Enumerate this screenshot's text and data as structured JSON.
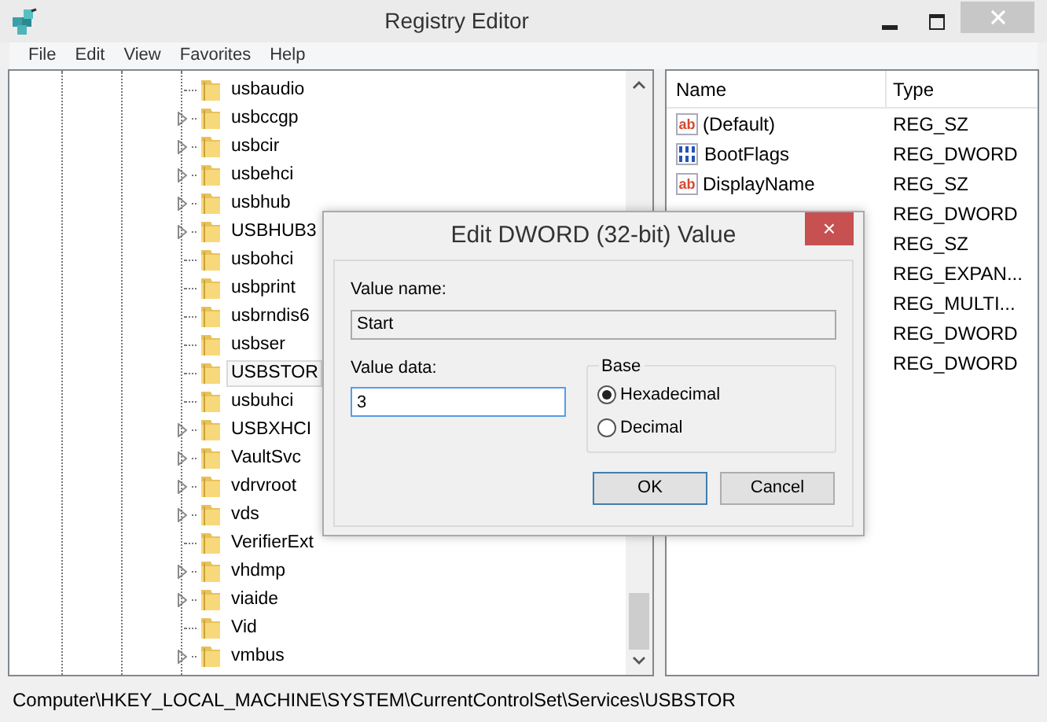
{
  "window": {
    "title": "Registry Editor"
  },
  "menu": [
    "File",
    "Edit",
    "View",
    "Favorites",
    "Help"
  ],
  "tree": [
    {
      "label": "usbaudio",
      "expandable": false,
      "selected": false
    },
    {
      "label": "usbccgp",
      "expandable": true,
      "selected": false
    },
    {
      "label": "usbcir",
      "expandable": true,
      "selected": false
    },
    {
      "label": "usbehci",
      "expandable": true,
      "selected": false
    },
    {
      "label": "usbhub",
      "expandable": true,
      "selected": false
    },
    {
      "label": "USBHUB3",
      "expandable": true,
      "selected": false
    },
    {
      "label": "usbohci",
      "expandable": false,
      "selected": false
    },
    {
      "label": "usbprint",
      "expandable": false,
      "selected": false
    },
    {
      "label": "usbrndis6",
      "expandable": false,
      "selected": false
    },
    {
      "label": "usbser",
      "expandable": false,
      "selected": false
    },
    {
      "label": "USBSTOR",
      "expandable": false,
      "selected": true
    },
    {
      "label": "usbuhci",
      "expandable": false,
      "selected": false
    },
    {
      "label": "USBXHCI",
      "expandable": true,
      "selected": false
    },
    {
      "label": "VaultSvc",
      "expandable": true,
      "selected": false
    },
    {
      "label": "vdrvroot",
      "expandable": true,
      "selected": false
    },
    {
      "label": "vds",
      "expandable": true,
      "selected": false
    },
    {
      "label": "VerifierExt",
      "expandable": false,
      "selected": false
    },
    {
      "label": "vhdmp",
      "expandable": true,
      "selected": false
    },
    {
      "label": "viaide",
      "expandable": true,
      "selected": false
    },
    {
      "label": "Vid",
      "expandable": false,
      "selected": false
    },
    {
      "label": "vmbus",
      "expandable": true,
      "selected": false
    }
  ],
  "values": {
    "columns": [
      "Name",
      "Type"
    ],
    "rows": [
      {
        "name": "(Default)",
        "kind": "string",
        "icon_text": "ab",
        "type": "REG_SZ"
      },
      {
        "name": "BootFlags",
        "kind": "binary",
        "type": "REG_DWORD"
      },
      {
        "name": "DisplayName",
        "kind": "string",
        "icon_text": "ab",
        "type": "REG_SZ"
      },
      {
        "type": "REG_DWORD"
      },
      {
        "type": "REG_SZ"
      },
      {
        "type": "REG_EXPAN..."
      },
      {
        "type": "REG_MULTI..."
      },
      {
        "type": "REG_DWORD"
      },
      {
        "type": "REG_DWORD"
      }
    ]
  },
  "status_bar": "Computer\\HKEY_LOCAL_MACHINE\\SYSTEM\\CurrentControlSet\\Services\\USBSTOR",
  "dialog": {
    "title": "Edit DWORD (32-bit) Value",
    "close": "×",
    "value_name_label": "Value name:",
    "value_name": "Start",
    "value_data_label": "Value data:",
    "value_data": "3",
    "base_label": "Base",
    "bases": [
      {
        "label": "Hexadecimal",
        "selected": true
      },
      {
        "label": "Decimal",
        "selected": false
      }
    ],
    "buttons": [
      "OK",
      "Cancel"
    ]
  }
}
